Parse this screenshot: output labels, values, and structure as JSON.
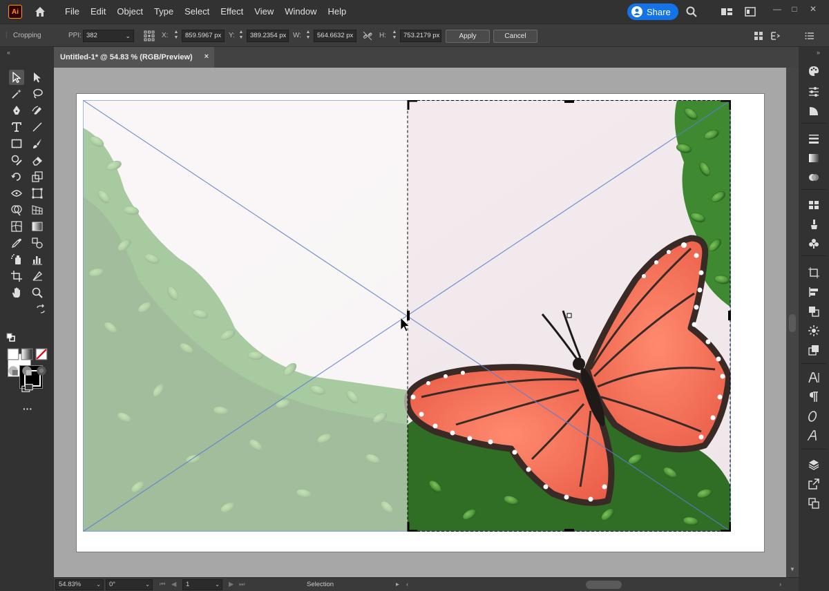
{
  "app": {
    "logo_text": "Ai"
  },
  "menu": [
    "File",
    "Edit",
    "Object",
    "Type",
    "Select",
    "Effect",
    "View",
    "Window",
    "Help"
  ],
  "share": {
    "label": "Share"
  },
  "control_bar": {
    "mode_label": "Cropping",
    "ppi_label": "PPI:",
    "ppi_value": "382",
    "x_label": "X:",
    "x_value": "859.5967 px",
    "y_label": "Y:",
    "y_value": "389.2354 px",
    "w_label": "W:",
    "w_value": "564.6632 px",
    "h_label": "H:",
    "h_value": "753.2179 px",
    "apply_label": "Apply",
    "cancel_label": "Cancel"
  },
  "document_tab": {
    "title": "Untitled-1* @ 54.83 % (RGB/Preview)",
    "close": "×"
  },
  "status_bar": {
    "zoom": "54.83%",
    "rotation": "0°",
    "artboard_number": "1",
    "tool_name": "Selection"
  },
  "colors": {
    "accent": "#1473e6",
    "menubar": "#323232",
    "canvas": "#a7a7a7",
    "butterfly": "#f06a55",
    "leaves": "#4f9a3a"
  }
}
